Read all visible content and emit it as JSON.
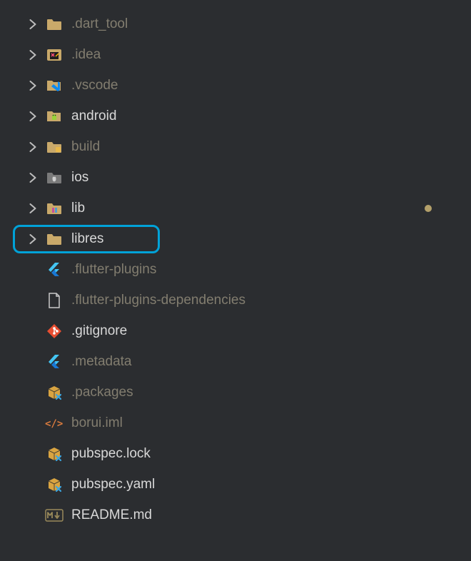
{
  "tree": {
    "items": [
      {
        "label": ".dart_tool",
        "chevron": true,
        "iconType": "folder-generic",
        "color": "dim"
      },
      {
        "label": ".idea",
        "chevron": true,
        "iconType": "folder-idea",
        "color": "dim"
      },
      {
        "label": ".vscode",
        "chevron": true,
        "iconType": "folder-vscode",
        "color": "dim"
      },
      {
        "label": "android",
        "chevron": true,
        "iconType": "folder-android",
        "color": "bright"
      },
      {
        "label": "build",
        "chevron": true,
        "iconType": "folder-build",
        "color": "dim"
      },
      {
        "label": "ios",
        "chevron": true,
        "iconType": "folder-ios",
        "color": "bright"
      },
      {
        "label": "lib",
        "chevron": true,
        "iconType": "folder-lib",
        "color": "bright",
        "dot": true
      },
      {
        "label": "libres",
        "chevron": true,
        "iconType": "folder-generic",
        "color": "bright",
        "highlighted": true
      },
      {
        "label": ".flutter-plugins",
        "chevron": false,
        "iconType": "flutter",
        "color": "dim"
      },
      {
        "label": ".flutter-plugins-dependencies",
        "chevron": false,
        "iconType": "file",
        "color": "dim"
      },
      {
        "label": ".gitignore",
        "chevron": false,
        "iconType": "git",
        "color": "bright"
      },
      {
        "label": ".metadata",
        "chevron": false,
        "iconType": "flutter",
        "color": "dim"
      },
      {
        "label": ".packages",
        "chevron": false,
        "iconType": "package",
        "color": "dim"
      },
      {
        "label": "borui.iml",
        "chevron": false,
        "iconType": "iml",
        "color": "dim"
      },
      {
        "label": "pubspec.lock",
        "chevron": false,
        "iconType": "package",
        "color": "bright"
      },
      {
        "label": "pubspec.yaml",
        "chevron": false,
        "iconType": "package",
        "color": "bright"
      },
      {
        "label": "README.md",
        "chevron": false,
        "iconType": "markdown",
        "color": "bright"
      }
    ]
  }
}
